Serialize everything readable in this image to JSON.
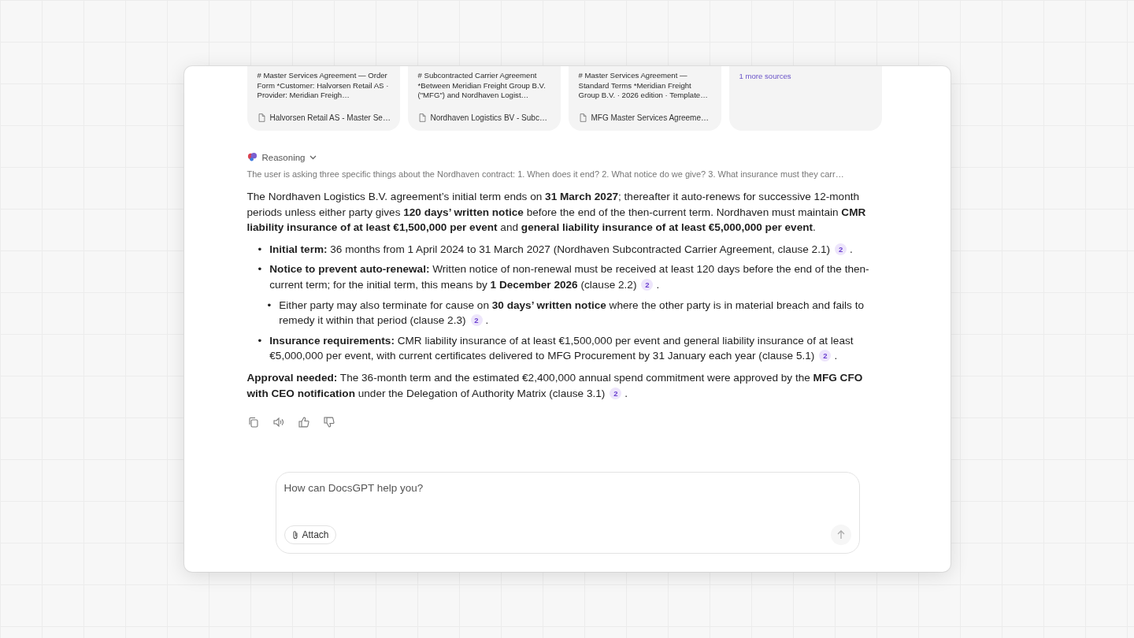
{
  "sources": [
    {
      "snippet": "# Master Services Agreement — Order Form *Customer: Halvorsen Retail AS · Provider: Meridian Freigh…",
      "file": "Halvorsen Retail AS - Master Se…"
    },
    {
      "snippet": "# Subcontracted Carrier Agreement *Between Meridian Freight Group B.V. (\"MFG\") and Nordhaven Logist…",
      "file": "Nordhaven Logistics BV - Subc…"
    },
    {
      "snippet": "# Master Services Agreement — Standard Terms *Meridian Freight Group B.V. · 2026 edition · Template…",
      "file": "MFG Master Services Agreeme…"
    }
  ],
  "more_sources": "1 more sources",
  "reasoning": {
    "label": "Reasoning",
    "summary": "The user is asking three specific things about the Nordhaven contract: 1. When does it end? 2. What notice do we give? 3. What insurance must they carr…"
  },
  "answer": {
    "intro": "The Nordhaven Logistics B.V. agreement’s initial term ends on **31 March 2027**; thereafter it auto-renews for successive 12-month periods unless either party gives **120 days’ written notice** before the end of the then-current term. Nordhaven must maintain **CMR liability insurance of at least €1,500,000 per event** and **general liability insurance of at least €5,000,000 per event**.",
    "bullets": [
      {
        "marker": "•",
        "text": "**Initial term:** 36 months from 1 April 2024 to 31 March 2027 (Nordhaven Subcontracted Carrier Agreement, clause 2.1)",
        "citation": "2",
        "tail": "."
      },
      {
        "marker": "•",
        "text": "**Notice to prevent auto-renewal:** Written notice of non-renewal must be received at least 120 days before the end of the then-current term; for the initial term, this means by **1 December 2026** (clause 2.2)",
        "citation": "2",
        "tail": ".",
        "children": [
          {
            "marker": "•",
            "text": "Either party may also terminate for cause on **30 days’ written notice** where the other party is in material breach and fails to remedy it within that period (clause 2.3)",
            "citation": "2",
            "tail": "."
          }
        ]
      },
      {
        "marker": "•",
        "text": "**Insurance requirements:** CMR liability insurance of at least €1,500,000 per event and general liability insurance of at least €5,000,000 per event, with current certificates delivered to MFG Procurement by 31 January each year (clause 5.1)",
        "citation": "2",
        "tail": "."
      }
    ],
    "closing": {
      "text": "**Approval needed:** The 36-month term and the estimated €2,400,000 annual spend commitment were approved by the **MFG CFO with CEO notification** under the Delegation of Authority Matrix (clause 3.1)",
      "citation": "2",
      "tail": "."
    }
  },
  "composer": {
    "placeholder": "How can DocsGPT help you?",
    "attach": "Attach"
  }
}
